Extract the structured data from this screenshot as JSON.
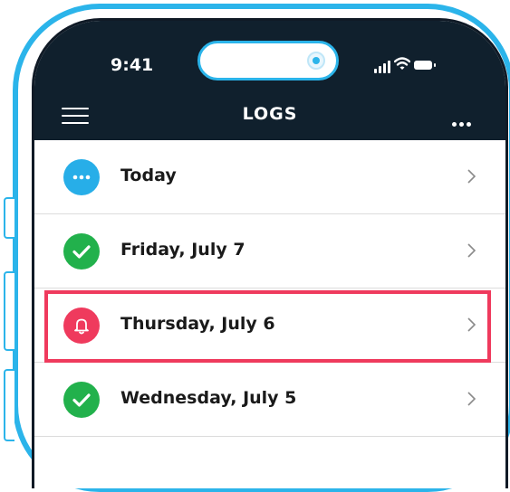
{
  "status_bar": {
    "time": "9:41"
  },
  "nav": {
    "title": "LOGS",
    "menu_icon": "hamburger-menu-icon",
    "more_icon": "more-dots-icon"
  },
  "logs": [
    {
      "label": "Today",
      "status": "in-progress",
      "icon": "dots-icon",
      "color": "#27aee8"
    },
    {
      "label": "Friday, July 7",
      "status": "complete",
      "icon": "check-icon",
      "color": "#22b14c"
    },
    {
      "label": "Thursday, July 6",
      "status": "alert",
      "icon": "bell-icon",
      "color": "#ef3a5d",
      "highlighted": true
    },
    {
      "label": "Wednesday, July 5",
      "status": "complete",
      "icon": "check-icon",
      "color": "#22b14c"
    }
  ],
  "colors": {
    "frame": "#2bb4ea",
    "header": "#10202d",
    "highlight": "#ef3a5d"
  }
}
